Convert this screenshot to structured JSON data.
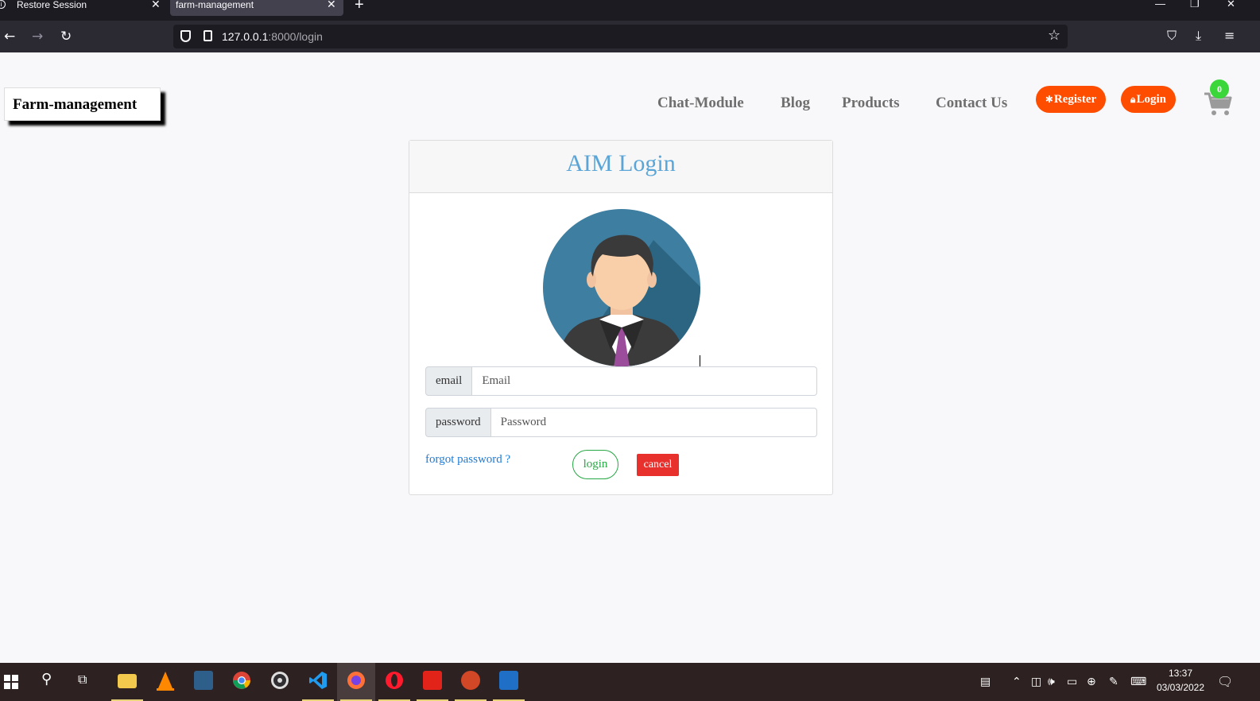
{
  "browser": {
    "tabs": [
      {
        "title": "Restore Session",
        "active": false
      },
      {
        "title": "farm-management",
        "active": true
      }
    ],
    "new_tab": "+",
    "url_host": "127.0.0.1",
    "url_rest": ":8000/login",
    "window_controls": {
      "minimize": "—",
      "restore": "❐",
      "close": "✕"
    },
    "icons": [
      "back-arrow-icon",
      "forward-arrow-icon",
      "reload-icon",
      "shield-icon",
      "page-icon",
      "bookmark-star-icon",
      "pocket-icon",
      "download-icon",
      "menu-icon"
    ]
  },
  "site": {
    "brand": "Farm-management",
    "nav": [
      "Chat-Module",
      "Blog",
      "Products",
      "Contact Us"
    ],
    "register_label": "Register",
    "login_label": "Login",
    "cart_count": "0",
    "accent_color": "#ff4d00"
  },
  "login_form": {
    "title": "AIM Login",
    "email_label": "email",
    "email_placeholder": "Email",
    "password_label": "password",
    "password_placeholder": "Password",
    "forgot_link": "forgot password ?",
    "login_button": "login",
    "cancel_button": "cancel"
  },
  "taskbar": {
    "apps": [
      "windows-start-icon",
      "search-icon",
      "task-view-icon",
      "file-explorer-icon",
      "vlc-icon",
      "mysql-workbench-icon",
      "chrome-icon",
      "obs-icon",
      "vscode-icon",
      "firefox-icon",
      "opera-icon",
      "acrobat-icon",
      "powerpoint-icon",
      "photos-icon"
    ],
    "time": "13:37",
    "date": "03/03/2022"
  }
}
